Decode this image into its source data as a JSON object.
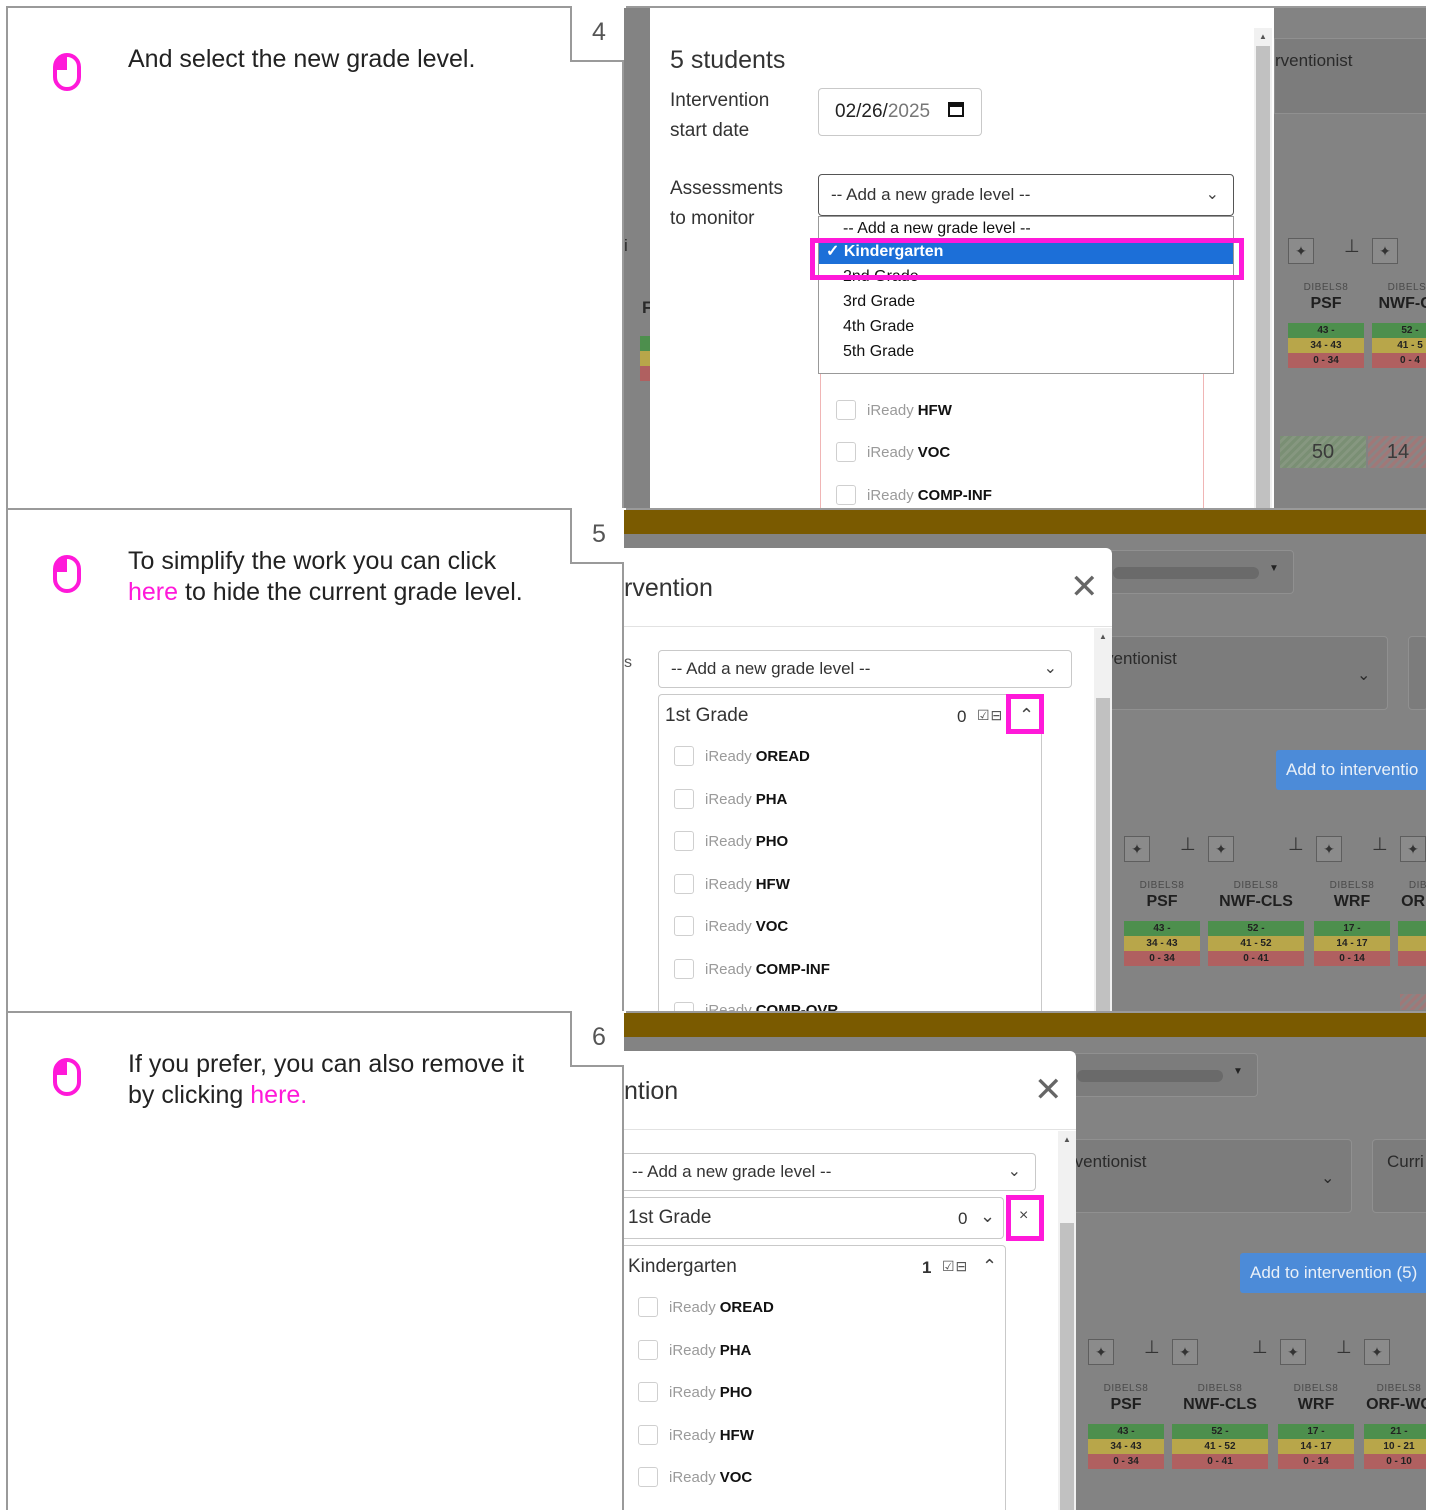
{
  "steps": [
    {
      "number": "4",
      "text_before": "And select the new grade level.",
      "link": "",
      "text_after": ""
    },
    {
      "number": "5",
      "text_before": "To simplify the work you can click ",
      "link": "here",
      "text_after": " to hide the current grade level."
    },
    {
      "number": "6",
      "text_before": "If you prefer, you can also remove it by clicking ",
      "link": "here.",
      "text_after": ""
    }
  ],
  "colors": {
    "highlight": "#ff19d9",
    "dropdown_selected": "#1c6fd8",
    "overlay_gold": "#7a5a00"
  },
  "shot4": {
    "students": "5 students",
    "start_date_label": "Intervention start date",
    "start_date_label_l1": "Intervention",
    "start_date_label_l2": "start date",
    "date_mm_dd": "02/26/",
    "date_yyyy": "2025",
    "calendar_icon": "calendar-icon",
    "assess_label_l1": "Assessments",
    "assess_label_l2": "to monitor",
    "select_value": "-- Add a new grade level --",
    "options": [
      "-- Add a new grade level --",
      "✓ Kindergarten",
      "2nd Grade",
      "3rd Grade",
      "4th Grade",
      "5th Grade"
    ],
    "selected_option": "✓ Kindergarten",
    "items": [
      {
        "pre": "iReady",
        "name": "HFW"
      },
      {
        "pre": "iReady",
        "name": "VOC"
      },
      {
        "pre": "iReady",
        "name": "COMP-INF"
      }
    ],
    "bg": {
      "interventionist": "rventionist",
      "col_src": [
        "DIBELS8",
        "DIBELS8"
      ],
      "col_names": [
        "PSF",
        "NWF-CL"
      ],
      "bands": [
        [
          "43 -",
          "34 - 43",
          "0 - 34"
        ],
        [
          "52 -",
          "41 - 5",
          "0 - 4"
        ]
      ],
      "hatch_vals": [
        "50",
        "14"
      ],
      "pin_glyph": "⊥",
      "sparkle_glyph": "✦",
      "left_letters": [
        "i",
        "F",
        "3"
      ]
    }
  },
  "shot5": {
    "modal_title": "rvention",
    "select_value": "-- Add a new grade level --",
    "grade_title": "1st Grade",
    "grade_count": "0",
    "items": [
      {
        "pre": "iReady",
        "name": "OREAD"
      },
      {
        "pre": "iReady",
        "name": "PHA"
      },
      {
        "pre": "iReady",
        "name": "PHO"
      },
      {
        "pre": "iReady",
        "name": "HFW"
      },
      {
        "pre": "iReady",
        "name": "VOC"
      },
      {
        "pre": "iReady",
        "name": "COMP-INF"
      },
      {
        "pre": "iReady",
        "name": "COMP-OVR"
      }
    ],
    "bg": {
      "interventionist": "ventionist",
      "add_button": "Add to interventio",
      "col_src": [
        "DIBELS8",
        "DIBELS8",
        "DIBELS8",
        "DIB"
      ],
      "col_names": [
        "PSF",
        "NWF-CLS",
        "WRF",
        "ORF"
      ],
      "bands": [
        [
          "43 -",
          "34 - 43",
          "0 - 34"
        ],
        [
          "52 -",
          "41 - 52",
          "0 - 41"
        ],
        [
          "17 -",
          "14 - 17",
          "0 - 14"
        ],
        [
          "",
          "",
          ""
        ]
      ]
    }
  },
  "shot6": {
    "modal_title": "ntion",
    "select_value": "-- Add a new grade level --",
    "grade1_title": "1st Grade",
    "grade1_count": "0",
    "remove_glyph": "×",
    "grade2_title": "Kindergarten",
    "grade2_count": "1",
    "items": [
      {
        "pre": "iReady",
        "name": "OREAD"
      },
      {
        "pre": "iReady",
        "name": "PHA"
      },
      {
        "pre": "iReady",
        "name": "PHO"
      },
      {
        "pre": "iReady",
        "name": "HFW"
      },
      {
        "pre": "iReady",
        "name": "VOC"
      }
    ],
    "bg": {
      "interventionist": "rventionist",
      "curri": "Curri",
      "add_button": "Add to intervention (5)",
      "col_src": [
        "DIBELS8",
        "DIBELS8",
        "DIBELS8",
        "DIBELS8"
      ],
      "col_names": [
        "PSF",
        "NWF-CLS",
        "WRF",
        "ORF-WC"
      ],
      "bands": [
        [
          "43 -",
          "34 - 43",
          "0 - 34"
        ],
        [
          "52 -",
          "41 - 52",
          "0 - 41"
        ],
        [
          "17 -",
          "14 - 17",
          "0 - 14"
        ],
        [
          "21 -",
          "10 - 21",
          "0 - 10"
        ]
      ]
    }
  }
}
